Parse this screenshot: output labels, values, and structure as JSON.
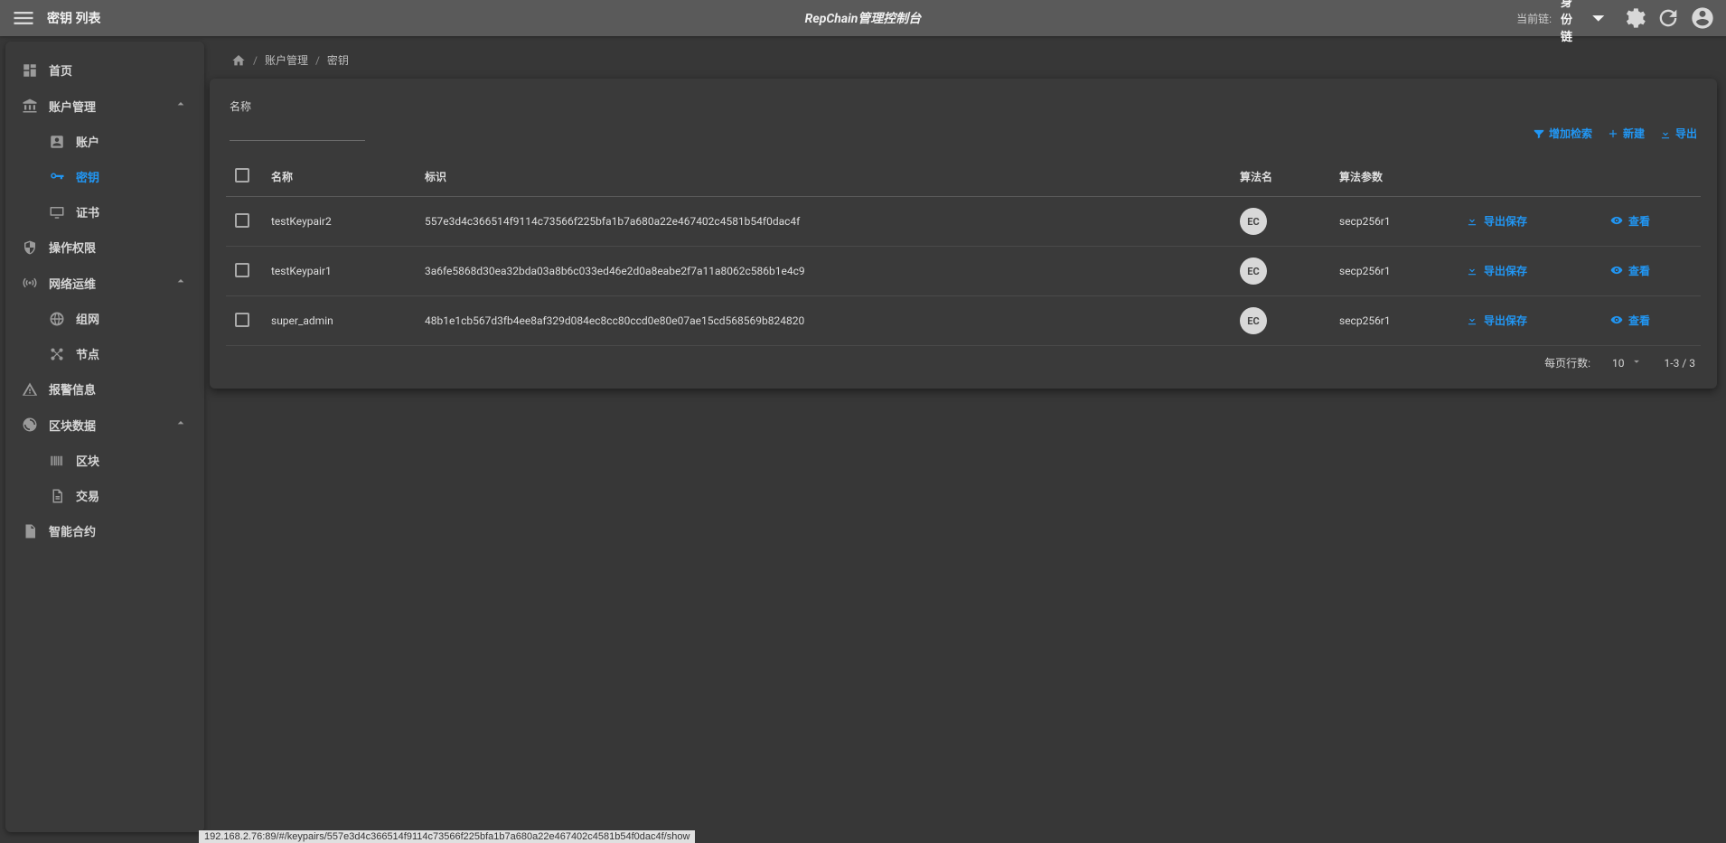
{
  "topbar": {
    "page_title": "密钥 列表",
    "app_title": "RepChain管理控制台",
    "chain_label": "当前链:",
    "chain_value": "身份链"
  },
  "sidebar": {
    "items": [
      {
        "label": "首页",
        "icon": "dashboard-icon"
      },
      {
        "label": "账户管理",
        "icon": "bank-icon",
        "expand": true,
        "children": [
          {
            "label": "账户",
            "icon": "account-box-icon"
          },
          {
            "label": "密钥",
            "icon": "key-icon",
            "active": true
          },
          {
            "label": "证书",
            "icon": "monitor-icon"
          }
        ]
      },
      {
        "label": "操作权限",
        "icon": "shield-icon"
      },
      {
        "label": "网络运维",
        "icon": "broadcast-icon",
        "expand": true,
        "children": [
          {
            "label": "组网",
            "icon": "globe-icon"
          },
          {
            "label": "节点",
            "icon": "nodes-icon"
          }
        ]
      },
      {
        "label": "报警信息",
        "icon": "alert-icon"
      },
      {
        "label": "区块数据",
        "icon": "progress-icon",
        "expand": true,
        "children": [
          {
            "label": "区块",
            "icon": "barcode-icon"
          },
          {
            "label": "交易",
            "icon": "doc-icon"
          }
        ]
      },
      {
        "label": "智能合约",
        "icon": "file-icon"
      }
    ]
  },
  "breadcrumb": {
    "items": [
      "账户管理",
      "密钥"
    ]
  },
  "filter": {
    "label": "名称",
    "value": ""
  },
  "actions": {
    "add_filter": "增加检索",
    "create": "新建",
    "export": "导出"
  },
  "table": {
    "headers": {
      "name": "名称",
      "identifier": "标识",
      "algorithm": "算法名",
      "params": "算法参数"
    },
    "rows": [
      {
        "name": "testKeypair2",
        "identifier": "557e3d4c366514f9114c73566f225bfa1b7a680a22e467402c4581b54f0dac4f",
        "algorithm": "EC",
        "params": "secp256r1",
        "export_label": "导出保存",
        "view_label": "查看"
      },
      {
        "name": "testKeypair1",
        "identifier": "3a6fe5868d30ea32bda03a8b6c033ed46e2d0a8eabe2f7a11a8062c586b1e4c9",
        "algorithm": "EC",
        "params": "secp256r1",
        "export_label": "导出保存",
        "view_label": "查看"
      },
      {
        "name": "super_admin",
        "identifier": "48b1e1cb567d3fb4ee8af329d084ec8cc80ccd0e80e07ae15cd568569b824820",
        "algorithm": "EC",
        "params": "secp256r1",
        "export_label": "导出保存",
        "view_label": "查看"
      }
    ]
  },
  "pagination": {
    "rows_per_page_label": "每页行数:",
    "rows_per_page": "10",
    "range": "1-3 / 3"
  },
  "statusbar": "192.168.2.76:89/#/keypairs/557e3d4c366514f9114c73566f225bfa1b7a680a22e467402c4581b54f0dac4f/show"
}
